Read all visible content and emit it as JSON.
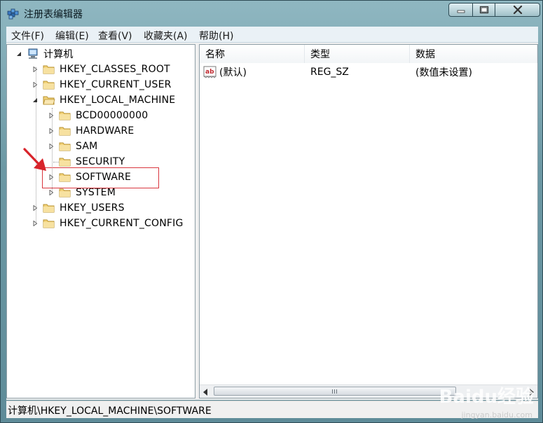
{
  "window": {
    "title": "注册表编辑器"
  },
  "menu": [
    "文件(F)",
    "编辑(E)",
    "查看(V)",
    "收藏夹(A)",
    "帮助(H)"
  ],
  "tree": {
    "root": "计算机",
    "items": [
      {
        "label": "HKEY_CLASSES_ROOT"
      },
      {
        "label": "HKEY_CURRENT_USER"
      },
      {
        "label": "HKEY_LOCAL_MACHINE"
      },
      {
        "label": "BCD00000000"
      },
      {
        "label": "HARDWARE"
      },
      {
        "label": "SAM"
      },
      {
        "label": "SECURITY"
      },
      {
        "label": "SOFTWARE"
      },
      {
        "label": "SYSTEM"
      },
      {
        "label": "HKEY_USERS"
      },
      {
        "label": "HKEY_CURRENT_CONFIG"
      }
    ]
  },
  "list": {
    "columns": [
      "名称",
      "类型",
      "数据"
    ],
    "rows": [
      {
        "name": "(默认)",
        "type": "REG_SZ",
        "data": "(数值未设置)"
      }
    ]
  },
  "status": {
    "path": "计算机\\HKEY_LOCAL_MACHINE\\SOFTWARE"
  },
  "watermark": {
    "brand": "Baidu经验",
    "url": "jingyan.baidu.com"
  },
  "icons": [
    "registry-app-icon",
    "minimize-icon",
    "maximize-icon",
    "close-icon",
    "computer-icon",
    "folder-icon",
    "expand-triangle-icon",
    "string-value-icon"
  ]
}
